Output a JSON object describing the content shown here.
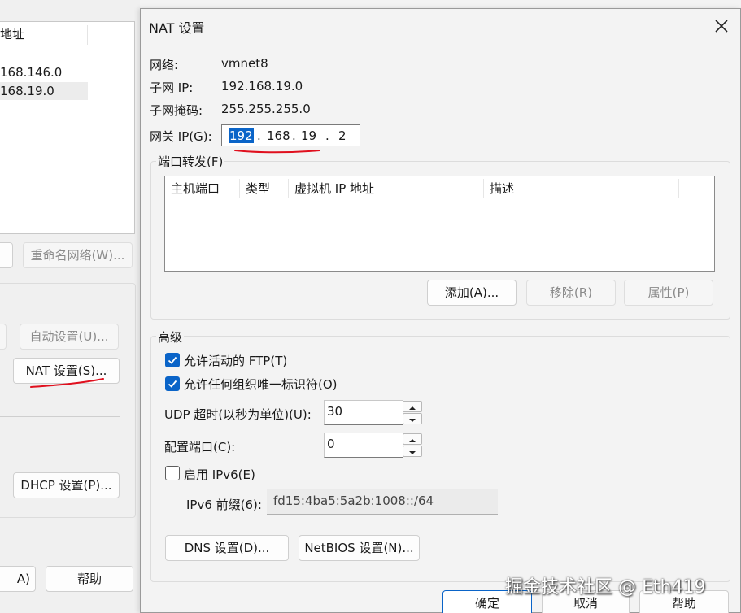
{
  "background_window": {
    "list": {
      "header": "地址",
      "rows": [
        "168.146.0",
        "168.19.0"
      ]
    },
    "rename_network_button": "重命名网络(W)...",
    "auto_settings_button": "自动设置(U)...",
    "nat_settings_button": "NAT 设置(S)...",
    "dhcp_settings_button": "DHCP 设置(P)...",
    "partial_button": "A)",
    "help_button": "帮助"
  },
  "dialog": {
    "title": "NAT 设置",
    "close_icon": "close-icon",
    "network_label": "网络:",
    "network_value": "vmnet8",
    "subnet_ip_label": "子网 IP:",
    "subnet_ip_value": "192.168.19.0",
    "subnet_mask_label": "子网掩码:",
    "subnet_mask_value": "255.255.255.0",
    "gateway_label": "网关 IP(G):",
    "gateway_octets": [
      "192",
      "168",
      "19",
      "2"
    ],
    "gateway_dot": ".",
    "port_forwarding": {
      "legend": "端口转发(F)",
      "columns": [
        "主机端口",
        "类型",
        "虚拟机 IP 地址",
        "描述"
      ],
      "add_button": "添加(A)...",
      "remove_button": "移除(R)",
      "properties_button": "属性(P)"
    },
    "advanced": {
      "legend": "高级",
      "allow_active_ftp": {
        "label": "允许活动的 FTP(T)",
        "checked": true
      },
      "allow_any_oui": {
        "label": "允许任何组织唯一标识符(O)",
        "checked": true
      },
      "udp_timeout_label": "UDP 超时(以秒为单位)(U):",
      "udp_timeout_value": "30",
      "config_port_label": "配置端口(C):",
      "config_port_value": "0",
      "enable_ipv6": {
        "label": "启用 IPv6(E)",
        "checked": false
      },
      "ipv6_prefix_label": "IPv6 前缀(6):",
      "ipv6_prefix_value": "fd15:4ba5:5a2b:1008::/64",
      "dns_button": "DNS 设置(D)...",
      "netbios_button": "NetBIOS 设置(N)..."
    },
    "ok_button": "确定",
    "cancel_button": "取消",
    "help_button": "帮助"
  },
  "watermark": "掘金技术社区 @ Eth419",
  "colors": {
    "accent": "#0a64c8",
    "annotation": "#e0101e"
  }
}
